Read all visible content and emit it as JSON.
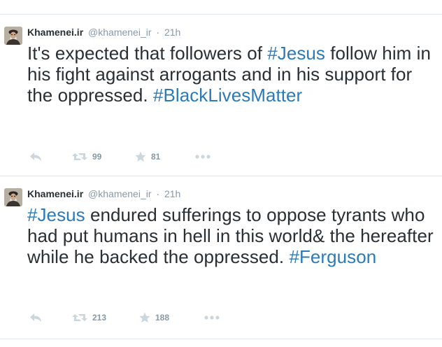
{
  "tweets": [
    {
      "author_name": "Khamenei.ir",
      "handle": "@khamenei_ir",
      "separator": "·",
      "time": "21h",
      "text_parts": [
        {
          "text": "It's expected that followers of ",
          "hashtag": false
        },
        {
          "text": "#Jesus",
          "hashtag": true
        },
        {
          "text": " follow him in his fight against arrogants and in his support for the oppressed. ",
          "hashtag": false
        },
        {
          "text": "#BlackLivesMatter",
          "hashtag": true
        }
      ],
      "retweet_count": "99",
      "favorite_count": "81"
    },
    {
      "author_name": "Khamenei.ir",
      "handle": "@khamenei_ir",
      "separator": "·",
      "time": "21h",
      "text_parts": [
        {
          "text": "#Jesus",
          "hashtag": true
        },
        {
          "text": " endured sufferings to oppose tyrants who had put humans in hell in this world& the hereafter while he backed the oppressed. ",
          "hashtag": false
        },
        {
          "text": "#Ferguson",
          "hashtag": true
        }
      ],
      "retweet_count": "213",
      "favorite_count": "188"
    }
  ],
  "colors": {
    "text": "#292f33",
    "muted": "#8899a6",
    "hashtag": "#2b7bb9",
    "icon": "#ccd6dd",
    "divider": "#e1e8ed"
  },
  "icons": [
    "reply-icon",
    "retweet-icon",
    "favorite-star-icon",
    "more-ellipsis-icon"
  ]
}
